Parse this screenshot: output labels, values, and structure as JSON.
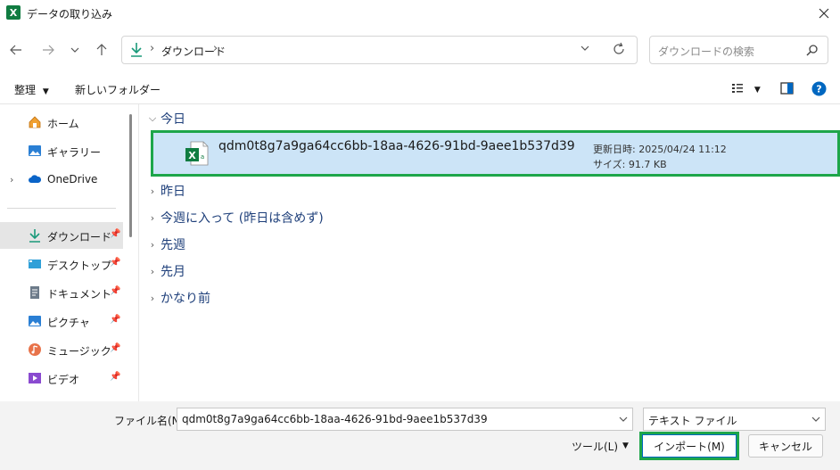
{
  "window": {
    "title": "データの取り込み",
    "app_icon_letter": "X"
  },
  "address": {
    "breadcrumb": "ダウンロード",
    "search_placeholder": "ダウンロードの検索"
  },
  "toolbar": {
    "organize": "整理",
    "new_folder": "新しいフォルダー"
  },
  "sidebar": {
    "items": [
      {
        "label": "ホーム",
        "icon": "home-icon"
      },
      {
        "label": "ギャラリー",
        "icon": "gallery-icon"
      },
      {
        "label": "OneDrive",
        "icon": "cloud-icon"
      },
      {
        "label": "ダウンロード",
        "icon": "download-icon"
      },
      {
        "label": "デスクトップ",
        "icon": "desktop-icon"
      },
      {
        "label": "ドキュメント",
        "icon": "document-icon"
      },
      {
        "label": "ピクチャ",
        "icon": "pictures-icon"
      },
      {
        "label": "ミュージック",
        "icon": "music-icon"
      },
      {
        "label": "ビデオ",
        "icon": "video-icon"
      }
    ]
  },
  "groups": {
    "today": "今日",
    "yesterday": "昨日",
    "this_week": "今週に入って (昨日は含めず)",
    "last_week": "先週",
    "last_month": "先月",
    "long_ago": "かなり前"
  },
  "file": {
    "name": "qdm0t8g7a9ga64cc6bb-18aa-4626-91bd-9aee1b537d39",
    "modified": "更新日時: 2025/04/24 11:12",
    "size": "サイズ: 91.7 KB"
  },
  "bottom": {
    "filename_label": "ファイル名(N):",
    "filename_value": "qdm0t8g7a9ga64cc6bb-18aa-4626-91bd-9aee1b537d39",
    "filetype_value": "テキスト ファイル",
    "tools_label": "ツール(L)",
    "import_label": "インポート(M)",
    "cancel_label": "キャンセル"
  },
  "colors": {
    "highlight": "#1ea64a",
    "selection": "#cce4f7",
    "excel_green": "#107c41"
  }
}
